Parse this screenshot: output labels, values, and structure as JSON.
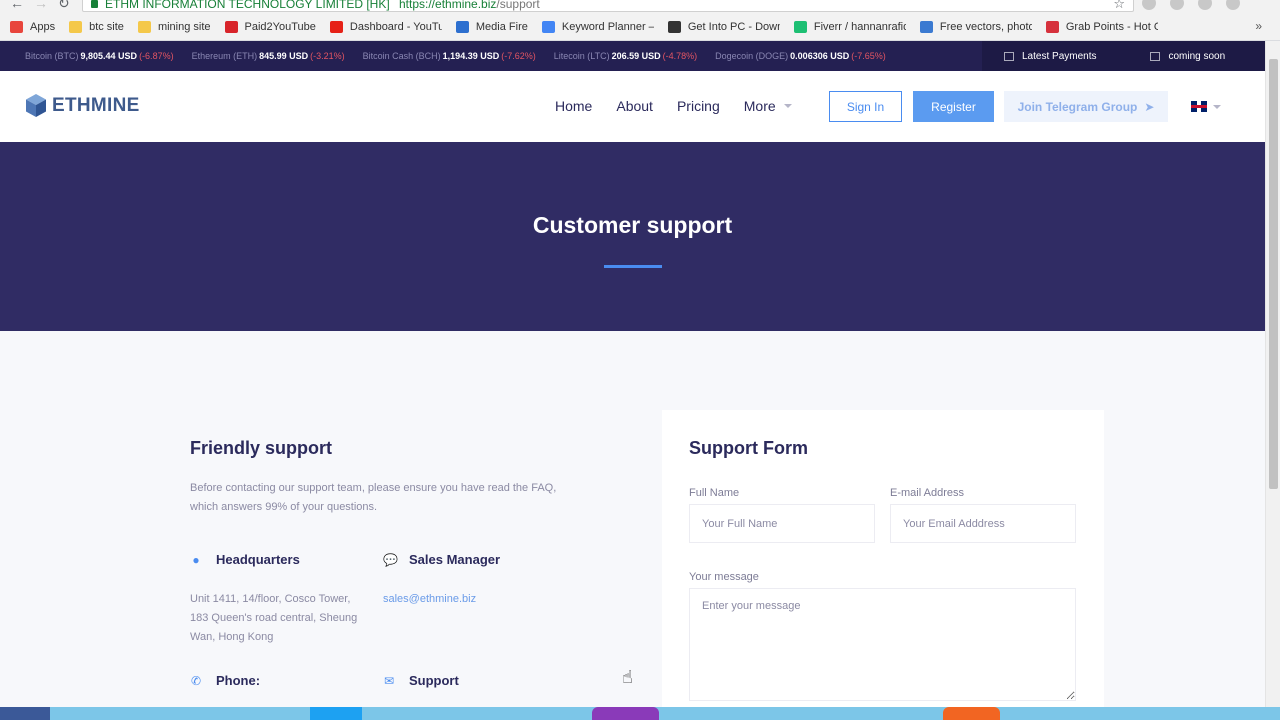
{
  "browser": {
    "site_name": "ETHM INFORMATION TECHNOLOGY LIMITED [HK]",
    "url_host": "https://ethmine.biz",
    "url_path": "/support",
    "bookmarks": [
      {
        "label": "Apps",
        "icon": "apps-grid-icon",
        "color": "#e8453c"
      },
      {
        "label": "btc site",
        "icon": "folder-icon",
        "color": "#f4c84a"
      },
      {
        "label": "mining site",
        "icon": "folder-icon",
        "color": "#f4c84a"
      },
      {
        "label": "Paid2YouTube",
        "icon": "paid2youtube-icon",
        "color": "#d8242a"
      },
      {
        "label": "Dashboard - YouTube",
        "icon": "youtube-icon",
        "color": "#e62117"
      },
      {
        "label": "Media Fire",
        "icon": "mediafire-icon",
        "color": "#2d6fcf"
      },
      {
        "label": "Keyword Planner – G",
        "icon": "adwords-icon",
        "color": "#4285f4"
      },
      {
        "label": "Get Into PC - Downlo",
        "icon": "getintopc-icon",
        "color": "#333333"
      },
      {
        "label": "Fiverr / hannanrafiq",
        "icon": "fiverr-icon",
        "color": "#1dbf73"
      },
      {
        "label": "Free vectors, photos",
        "icon": "freepik-icon",
        "color": "#3b7ad1"
      },
      {
        "label": "Grab Points - Hot Off",
        "icon": "grabpoints-icon",
        "color": "#d6313c"
      }
    ]
  },
  "ticker": {
    "items": [
      {
        "name": "Bitcoin (BTC)",
        "price": "9,805.44 USD",
        "change": "(-6.87%)"
      },
      {
        "name": "Ethereum (ETH)",
        "price": "845.99 USD",
        "change": "(-3.21%)"
      },
      {
        "name": "Bitcoin Cash (BCH)",
        "price": "1,194.39 USD",
        "change": "(-7.62%)"
      },
      {
        "name": "Litecoin (LTC)",
        "price": "206.59 USD",
        "change": "(-4.78%)"
      },
      {
        "name": "Dogecoin (DOGE)",
        "price": "0.006306 USD",
        "change": "(-7.65%)"
      }
    ],
    "latest_payments": "Latest Payments",
    "coming_soon": "coming soon"
  },
  "header": {
    "logo_text": "ETHMINE",
    "nav": [
      "Home",
      "About",
      "Pricing",
      "More"
    ],
    "sign_in": "Sign In",
    "register": "Register",
    "telegram": "Join Telegram Group"
  },
  "hero": {
    "title": "Customer support"
  },
  "support": {
    "title": "Friendly support",
    "description": "Before contacting our support team, please ensure you have read the FAQ, which answers 99% of your questions.",
    "headquarters_label": "Headquarters",
    "headquarters_address": "Unit 1411, 14/floor, Cosco Tower, 183 Queen's road central, Sheung Wan, Hong Kong",
    "sales_label": "Sales Manager",
    "sales_email": "sales@ethmine.biz",
    "phone_label": "Phone:",
    "support_label": "Support"
  },
  "form": {
    "title": "Support Form",
    "full_name_label": "Full Name",
    "full_name_placeholder": "Your Full Name",
    "email_label": "E-mail Address",
    "email_placeholder": "Your Email Adddress",
    "message_label": "Your message",
    "message_placeholder": "Enter your message"
  },
  "colors": {
    "ticker_bg": "#242052",
    "hero_bg": "#302c64",
    "accent": "#4a8cf0",
    "negative": "#e25563"
  }
}
